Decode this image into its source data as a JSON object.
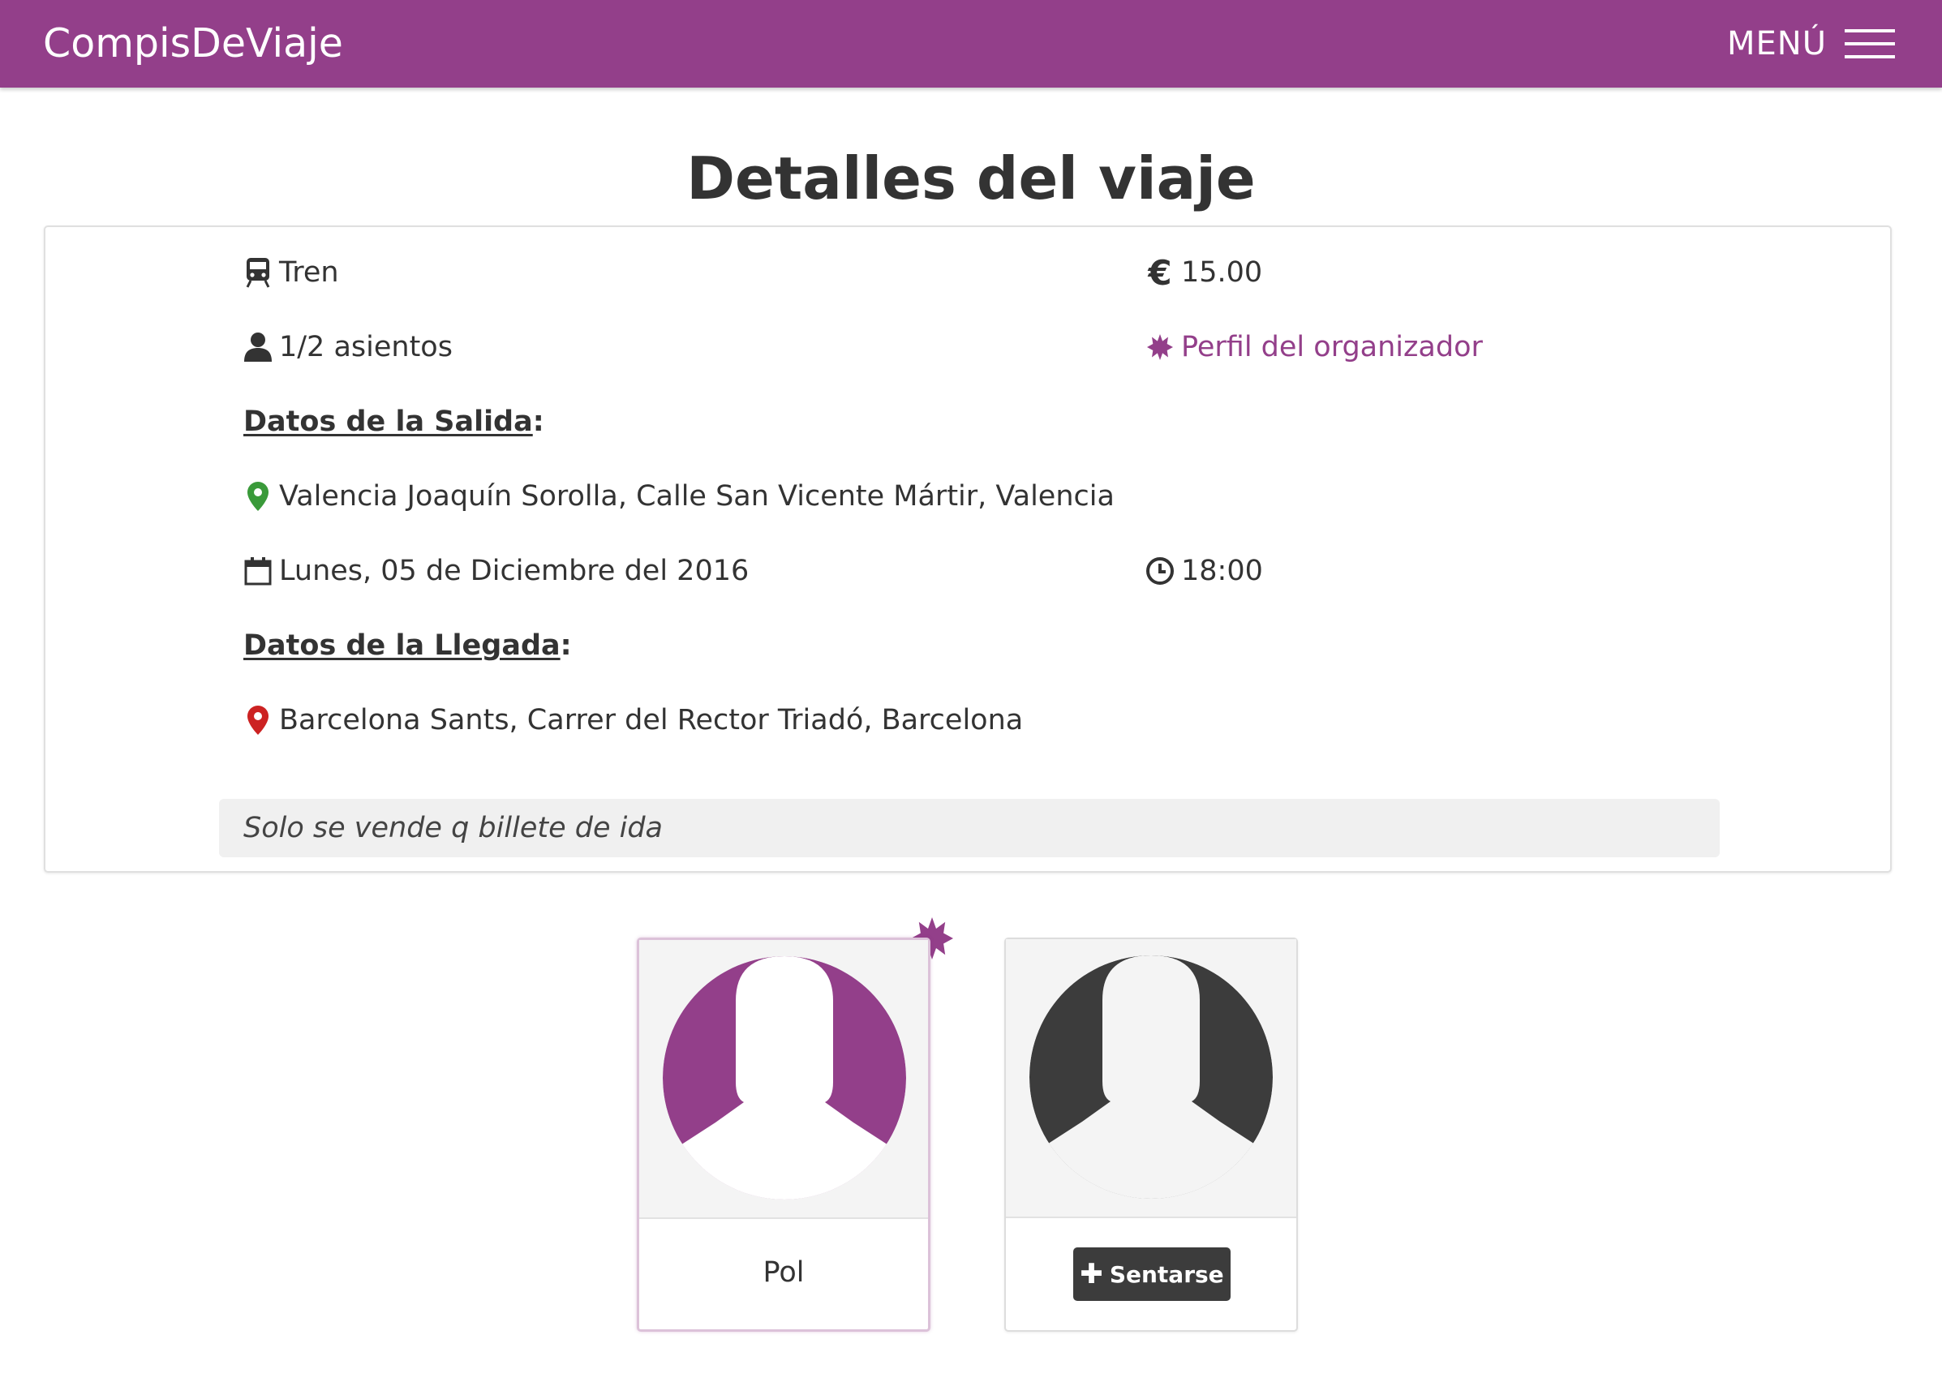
{
  "navbar": {
    "brand": "CompisDeViaje",
    "menu_label": "MENÚ",
    "color": "#933f8a"
  },
  "page_title": "Detalles del viaje",
  "trip": {
    "transport": {
      "icon": "train-icon",
      "label": "Tren"
    },
    "price": {
      "icon": "euro-icon",
      "value": "15.00"
    },
    "seats": {
      "icon": "user-icon",
      "label": "1/2 asientos"
    },
    "organizer_link": {
      "icon": "organizer-badge-icon",
      "label": "Perfil del organizador"
    },
    "departure": {
      "heading": "Datos de la Salida",
      "location": "Valencia Joaquín Sorolla, Calle San Vicente Mártir, Valencia",
      "location_icon_color": "#3a9a3a",
      "date": "Lunes, 05 de Diciembre del 2016",
      "time": "18:00"
    },
    "arrival": {
      "heading": "Datos de la Llegada",
      "location": "Barcelona Sants, Carrer del Rector Triadó, Barcelona",
      "location_icon_color": "#cc2222"
    },
    "notes": "Solo se vende q billete de ida"
  },
  "seats": [
    {
      "status": "taken",
      "name": "Pol",
      "is_organizer": true,
      "avatar_color": "#933f8a"
    },
    {
      "status": "free",
      "action_label": "Sentarse",
      "avatar_color": "#3c3c3c"
    }
  ],
  "colon": ":"
}
